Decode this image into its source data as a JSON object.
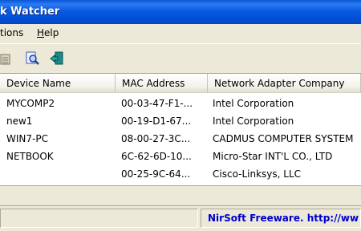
{
  "window": {
    "title": "k Watcher"
  },
  "menu": {
    "items": [
      "tions",
      "Help"
    ]
  },
  "toolbar": {
    "icons": [
      "properties-icon",
      "search-icon",
      "exit-icon"
    ]
  },
  "list": {
    "columns": [
      "Device Name",
      "MAC Address",
      "Network Adapter Company"
    ],
    "rows": [
      [
        "MYCOMP2",
        "00-03-47-F1-...",
        "Intel Corporation"
      ],
      [
        "new1",
        "00-19-D1-67...",
        "Intel Corporation"
      ],
      [
        "WIN7-PC",
        "08-00-27-3C...",
        "CADMUS COMPUTER SYSTEM"
      ],
      [
        "NETBOOK",
        "6C-62-6D-10...",
        "Micro-Star INT'L CO., LTD"
      ],
      [
        "",
        "00-25-9C-64...",
        "Cisco-Linksys, LLC"
      ]
    ]
  },
  "status": {
    "link_text": "NirSoft Freeware.  http://ww"
  }
}
